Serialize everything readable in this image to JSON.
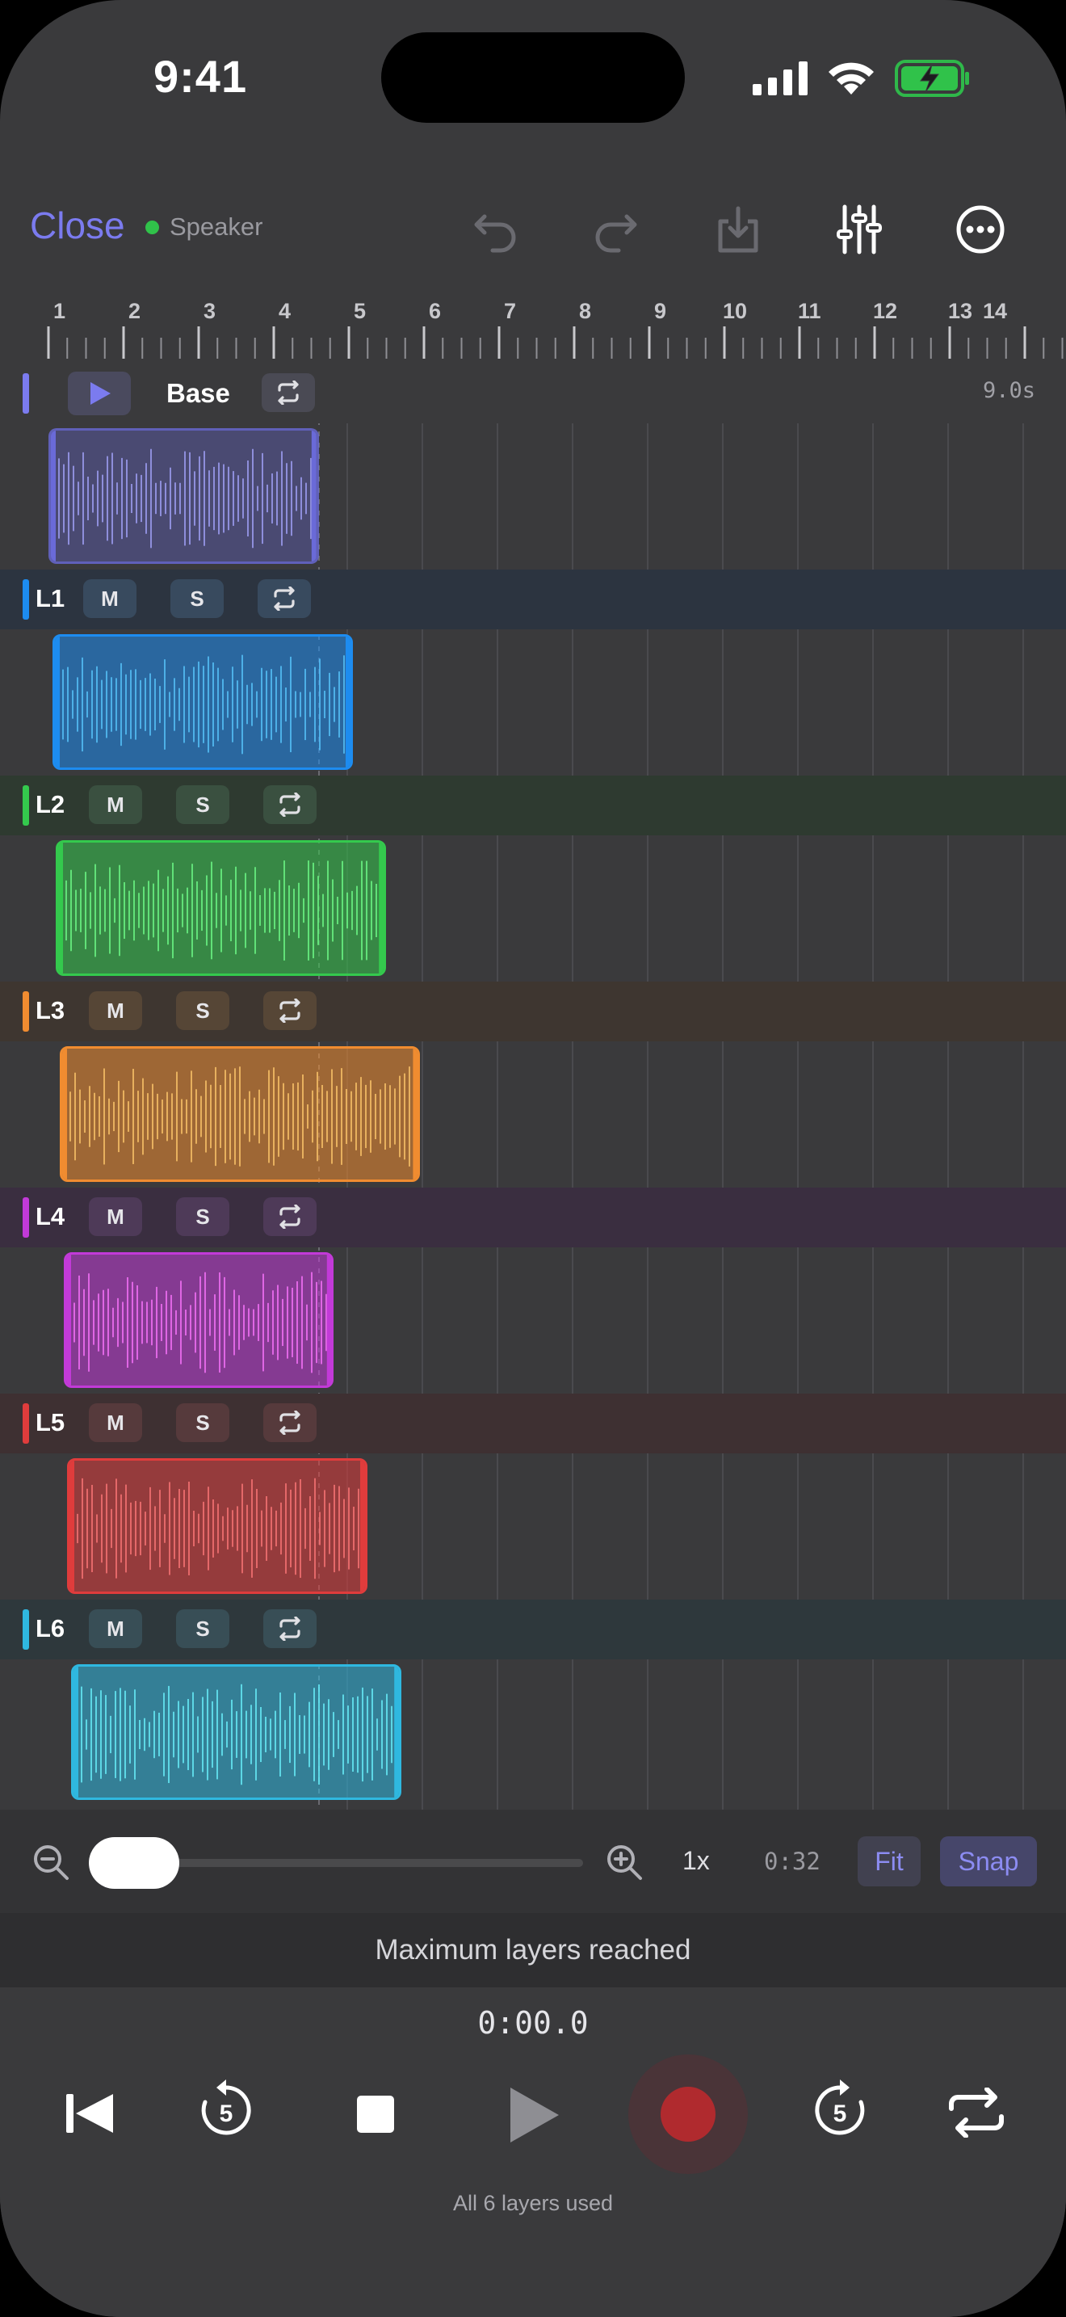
{
  "status_bar": {
    "time": "9:41"
  },
  "toolbar": {
    "close_label": "Close",
    "output_label": "Speaker",
    "output_dot_color": "#30c24a",
    "icons": [
      "undo-icon",
      "redo-icon",
      "save-download-icon",
      "mixer-sliders-icon",
      "more-icon"
    ]
  },
  "ruler": {
    "marks": [
      "1",
      "2",
      "3",
      "4",
      "5",
      "6",
      "7",
      "8",
      "9",
      "10",
      "11",
      "12",
      "13",
      "14"
    ]
  },
  "tracks": [
    {
      "id": "base",
      "label": "Base",
      "color": "#6a6ad8",
      "duration": "9.0s",
      "clip_start": 0,
      "clip_length": 3.6
    },
    {
      "id": "l1",
      "label": "L1",
      "mute": "M",
      "solo": "S",
      "color": "#1d8cf0",
      "clip_start": 0.05,
      "clip_length": 4.0
    },
    {
      "id": "l2",
      "label": "L2",
      "mute": "M",
      "solo": "S",
      "color": "#34c94d",
      "clip_start": 0.1,
      "clip_length": 4.4
    },
    {
      "id": "l3",
      "label": "L3",
      "mute": "M",
      "solo": "S",
      "color": "#f08c30",
      "clip_start": 0.15,
      "clip_length": 4.8
    },
    {
      "id": "l4",
      "label": "L4",
      "mute": "M",
      "solo": "S",
      "color": "#c23ad8",
      "clip_start": 0.2,
      "clip_length": 3.6
    },
    {
      "id": "l5",
      "label": "L5",
      "mute": "M",
      "solo": "S",
      "color": "#e03c3c",
      "clip_start": 0.25,
      "clip_length": 4.0
    },
    {
      "id": "l6",
      "label": "L6",
      "mute": "M",
      "solo": "S",
      "color": "#2fb8e0",
      "clip_start": 0.3,
      "clip_length": 4.4
    }
  ],
  "zoom": {
    "level": "1x",
    "total_time": "0:32",
    "fit_label": "Fit",
    "snap_label": "Snap",
    "slider_value": 0
  },
  "notice": {
    "text": "Maximum layers reached"
  },
  "transport": {
    "time": "0:00.0",
    "skip_back_seconds": "5",
    "skip_forward_seconds": "5",
    "footer": "All 6 layers used"
  }
}
